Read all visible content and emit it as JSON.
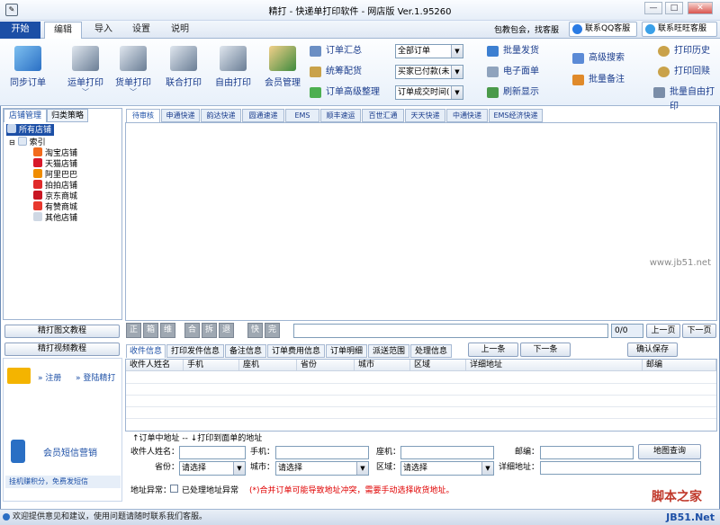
{
  "window": {
    "title": "精打 - 快递单打印软件 - 网店版 Ver.1.95260",
    "controls": [
      "—",
      "□",
      "✕"
    ]
  },
  "menu": {
    "tabs": [
      "开始",
      "编辑",
      "导入",
      "设置",
      "说明"
    ],
    "right_text": "包教包会，找客服",
    "qq_service": "联系QQ客服",
    "wangwang_service": "联系旺旺客服"
  },
  "ribbon": {
    "sync_orders": "同步订单",
    "waybill_print": "运单打印",
    "goods_print": "货单打印",
    "combined_print": "联合打印",
    "free_print": "自由打印",
    "member_mgmt": "会员管理",
    "order_summary": "订单汇总",
    "coord_goods": "统筹配货",
    "order_advanced": "订单高级整理",
    "filter_orders": "全部订单",
    "filter_buyer": "买家已付款(未",
    "filter_time": "订单成交时间(",
    "batch_ship": "批量发货",
    "e_waybill": "电子面单",
    "refresh": "刷新显示",
    "adv_search": "高级搜索",
    "batch_note": "批量备注",
    "print_history": "打印历史",
    "print_reprint": "打印回赎",
    "batch_free_print": "批量自由打印"
  },
  "left_panel": {
    "tabs": [
      "店铺管理",
      "归类策略"
    ],
    "tree_root": "所有店铺",
    "tree_index": "索引",
    "shops": [
      "淘宝店铺",
      "天猫店铺",
      "阿里巴巴",
      "拍拍店铺",
      "京东商城",
      "有赞商城",
      "其他店铺"
    ],
    "btn_tutorial_text": "精打图文教程",
    "btn_tutorial_video": "精打视频教程",
    "register": "注册",
    "login": "登陆精打",
    "sms_marketing": "会员短信营销",
    "earn_points": "挂机赚积分，免费发短信"
  },
  "grid_tabs": [
    "待审核",
    "申通快递",
    "韵达快递",
    "圆通速递",
    "EMS",
    "顺丰速运",
    "百世汇通",
    "天天快递",
    "中通快递",
    "EMS经济快递"
  ],
  "toolbar2": {
    "icons": [
      "正",
      "箱",
      "维",
      "合",
      "拆",
      "退",
      "快",
      "完"
    ],
    "page_value": "0/0",
    "prev_page": "上一页",
    "next_page": "下一页"
  },
  "detail": {
    "tabs": [
      "收件信息",
      "打印发件信息",
      "备注信息",
      "订单费用信息",
      "订单明细",
      "派送范围",
      "处理信息"
    ],
    "prev": "上一条",
    "next": "下一条",
    "confirm_save": "确认保存",
    "columns": [
      "收件人姓名",
      "手机",
      "座机",
      "省份",
      "城市",
      "区域",
      "详细地址",
      "邮编"
    ]
  },
  "address_form": {
    "note": "↑订单中地址  -- ↓打印到面单的地址",
    "name_label": "收件人姓名：",
    "mobile_label": "手机：",
    "phone_label": "座机：",
    "zip_label": "邮编：",
    "map_btn": "地图查询",
    "province_label": "省份：",
    "city_label": "城市：",
    "district_label": "区域：",
    "detail_label": "详细地址：",
    "select_placeholder": "请选择",
    "abnormal_label": "地址异常：",
    "handled_label": "已处理地址异常",
    "warning": "(*)合并订单可能导致地址冲突，需要手动选择收货地址。"
  },
  "status": {
    "text": "欢迎提供意见和建议，使用问题请随时联系我们客服。"
  },
  "watermarks": {
    "jb51": "www.jb51.net",
    "jiaoben": "脚本之家",
    "jb51_bottom": "JB51.Net"
  },
  "colors": {
    "accent": "#1a3c8c",
    "active_tab": "#1c4fa6",
    "warning": "#e00000"
  }
}
